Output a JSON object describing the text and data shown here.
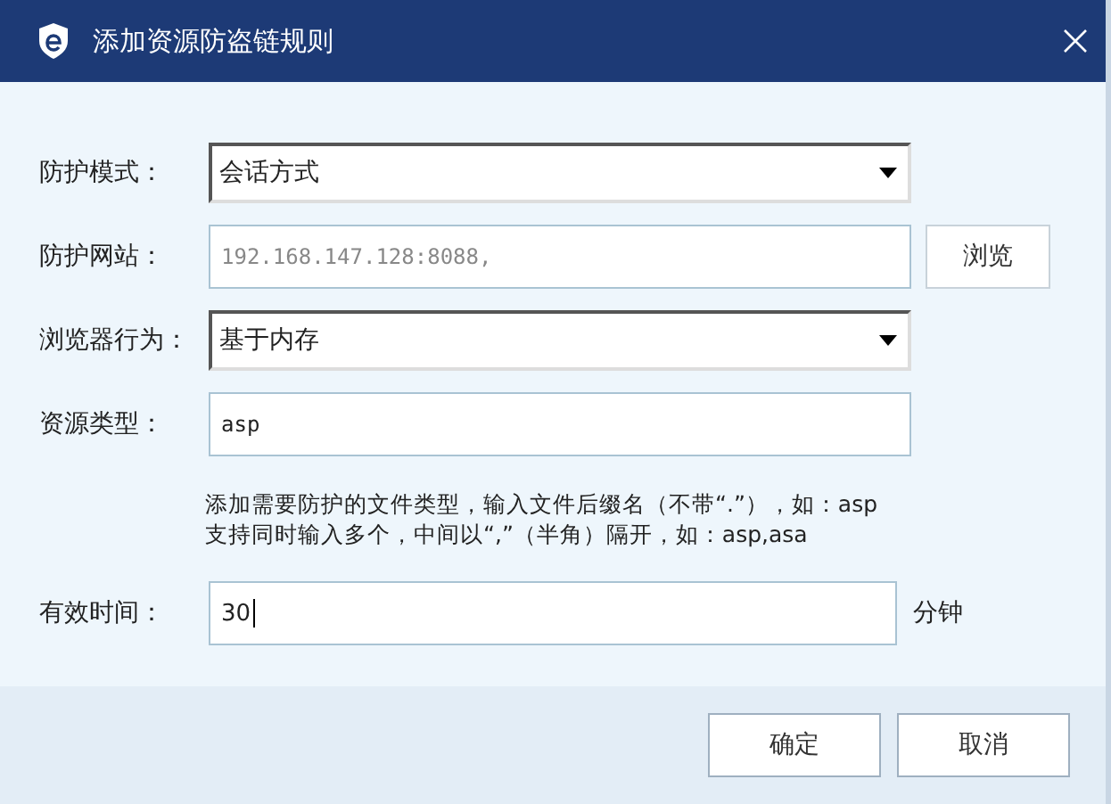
{
  "window": {
    "title": "添加资源防盗链规则"
  },
  "fields": [
    {
      "kind": "select",
      "label": "防护模式：",
      "value": "会话方式"
    },
    {
      "kind": "input",
      "label": "防护网站：",
      "placeholder": "192.168.147.128:8088,",
      "button": "浏览"
    },
    {
      "kind": "select",
      "label": "浏览器行为：",
      "value": "基于内存"
    },
    {
      "kind": "input",
      "label": "资源类型：",
      "value": "asp"
    },
    {
      "kind": "hint",
      "lines": [
        "添加需要防护的文件类型，输入文件后缀名（不带“.”），如：asp",
        "支持同时输入多个，中间以“,”（半角）隔开，如：asp,asa"
      ]
    },
    {
      "kind": "input",
      "label": "有效时间：",
      "value": "30",
      "focused": true,
      "unit": "分钟"
    }
  ],
  "buttons": [
    "确定",
    "取消"
  ]
}
